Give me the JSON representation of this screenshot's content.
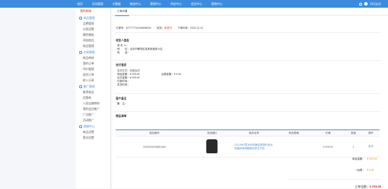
{
  "topbar": {
    "nav": [
      "首页",
      "活动管理",
      "大数据",
      "物流中心",
      "营销中心",
      "供应中心",
      "会员中心",
      "营销中心"
    ],
    "user": "闪闪云仓"
  },
  "sidebar": {
    "head": "我的商城",
    "sections": [
      {
        "title": "商品管理",
        "items": [
          "品牌管理",
          "分类设置",
          "属性模板",
          "添加商品",
          "商品管理"
        ]
      },
      {
        "title": "交易管理",
        "items": [
          "商品审核",
          "我的订单",
          "评价管理",
          "退货订单",
          "收入记录"
        ]
      },
      {
        "title": "推广营销",
        "items": [
          "推荐商品",
          "优惠券",
          "入驻店铺审核",
          "我的会员推广",
          "广告推广",
          "活动推广"
        ]
      },
      {
        "title": "商城中心",
        "items": [
          "商品设置",
          "营业设置"
        ]
      }
    ]
  },
  "main": {
    "tab": "订单详情",
    "order": {
      "no_label": "订单号：",
      "no": "427777741234596033",
      "status_label": "状态：",
      "status": "未发行",
      "time_label": "下单时间：",
      "time": "2020-12-14"
    },
    "receiver": {
      "title": "收货人信息",
      "name_label": "收 件 人：",
      "name": "",
      "phone_label": "电　　话：",
      "phone": "",
      "addr_label": "地　　址：",
      "addr": "北京市朝阳区某某街道某小区",
      "email_label": "邮　　编：",
      "email": ""
    },
    "payment": {
      "title": "支付信息",
      "method_label": "支付方式：",
      "method": "在线支付",
      "amount_label": "商品金额：",
      "amount": "¥ 203.00",
      "freight_label": "运费金额：",
      "freight": "¥ 0.00",
      "paid_label": "应付金额：",
      "paid": "¥ 203.00",
      "paytime_label": "付款时间：",
      "paytime": "",
      "shiptime_label": "发货时间：",
      "shiptime": ""
    },
    "remark": {
      "title": "客户备注",
      "label": "备　注：",
      "value": ""
    },
    "list": {
      "title": "商品清单",
      "headers": [
        "商品编号",
        "商品图片",
        "商品名称",
        "商品规格",
        "价格",
        "数量",
        "操作"
      ],
      "rows": [
        {
          "no": "0403234244861408",
          "img": "backpack-image",
          "name": "TUCANO意大利双肩包男旅行包大容量休闲电脑背包学生书包",
          "spec": "",
          "price": "¥ 203.00",
          "qty": "1",
          "op": "发货"
        }
      ]
    },
    "summary": {
      "goods_label": "商品金额：",
      "goods": "¥ 203.00",
      "freight_label": "+运费：",
      "freight": "¥ 0.00",
      "total_label": "订单金额：",
      "total": "¥ 203.00"
    }
  }
}
